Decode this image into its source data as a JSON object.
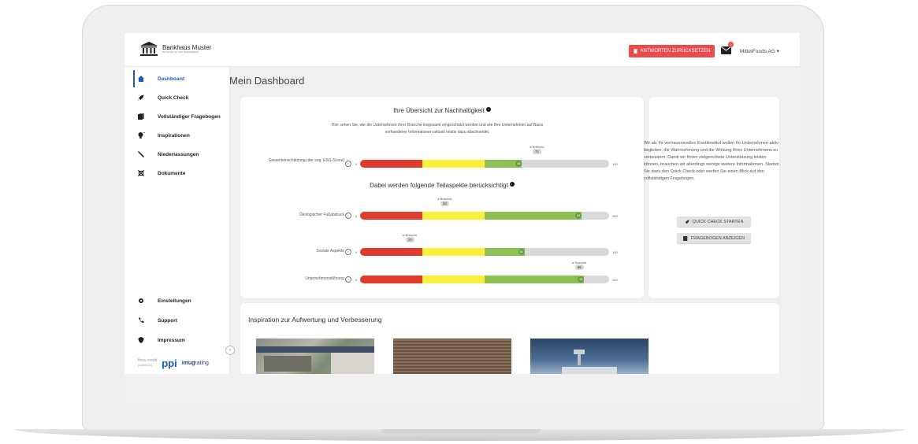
{
  "topbar": {
    "logo": {
      "name": "Bankhaus Muster",
      "tagline": "Ihr Partner für mehr Nachhaltigkeit"
    },
    "reset_button": "ANTWORTEN ZURÜCKSETZEN",
    "notification_count": "3",
    "account": "MitteIFoods AG ▾"
  },
  "sidebar": {
    "items": [
      {
        "label": "Dashboard",
        "icon": "home-icon"
      },
      {
        "label": "Quick Check",
        "icon": "rocket-icon"
      },
      {
        "label": "Vollständiger Fragebogen",
        "icon": "book-icon"
      },
      {
        "label": "Inspirationen",
        "icon": "lightbulb-icon"
      },
      {
        "label": "Niederlassungen",
        "icon": "wrench-icon"
      },
      {
        "label": "Dokumente",
        "icon": "document-icon"
      }
    ],
    "bottom_items": [
      {
        "label": "Einstellungen",
        "icon": "gear-icon"
      },
      {
        "label": "Support",
        "icon": "phone-icon"
      },
      {
        "label": "Impressum",
        "icon": "shield-icon"
      }
    ],
    "partners": {
      "left": "finsu credit",
      "left_sub": "powered by",
      "ppi": "ppi",
      "imug": "imug",
      "imug_suffix": "rating"
    }
  },
  "main": {
    "title": "Mein Dashboard",
    "overview": {
      "title": "Ihre Übersicht zur Nachhaltigkeit",
      "description": "Hier sehen Sie, wie die Unternehmen Ihrer Branche insgesamt eingeschätzt werden und wie Ihre Unternehmen auf Basis vorhandener Informationen aktuell relativ dazu abschneidet.",
      "aspects_title": "Dabei werden folgende Teilaspekte berücksichtigt",
      "branche_label": "ø Branche",
      "scale_min": "0",
      "scale_max": "100",
      "rows": [
        {
          "label": "Gesamteinschätzung\n(der sog. ESG-Score)",
          "value": 65,
          "branche": 71
        },
        {
          "label": "Ökologischer Fußabdruck",
          "value": 89,
          "branche": 34
        },
        {
          "label": "Soziale Aspekte",
          "value": 66,
          "branche": 20
        },
        {
          "label": "Unternehmensführung",
          "value": 90,
          "branche": 88
        }
      ]
    },
    "side_card": {
      "text": "Wir als Ihr vertrauensvolles Kreditinstitut wollen Ihr Unternehmen aktiv begleiten, die Wahrnehmung und die Wirkung Ihres Unternehmens zu verbessern. Damit wir Ihnen zielgerichtete Unterstützung leisten können, brauchen wir allerdings wenige weitere Informationen. Starten Sie dazu den Quick Check oder werfen Sie einen Blick auf den vollständigen Fragebogen.",
      "quick_check_button": "QUICK CHECK STARTEN",
      "questionnaire_button": "FRAGEBOGEN ANZEIGEN"
    },
    "inspiration": {
      "title": "Inspiration zur Aufwertung und Verbesserung"
    }
  },
  "colors": {
    "red": "#e03b2e",
    "yellow": "#f8ef3c",
    "green": "#8cc152",
    "accent": "#1f5ab9",
    "reset": "#e94c4c"
  }
}
